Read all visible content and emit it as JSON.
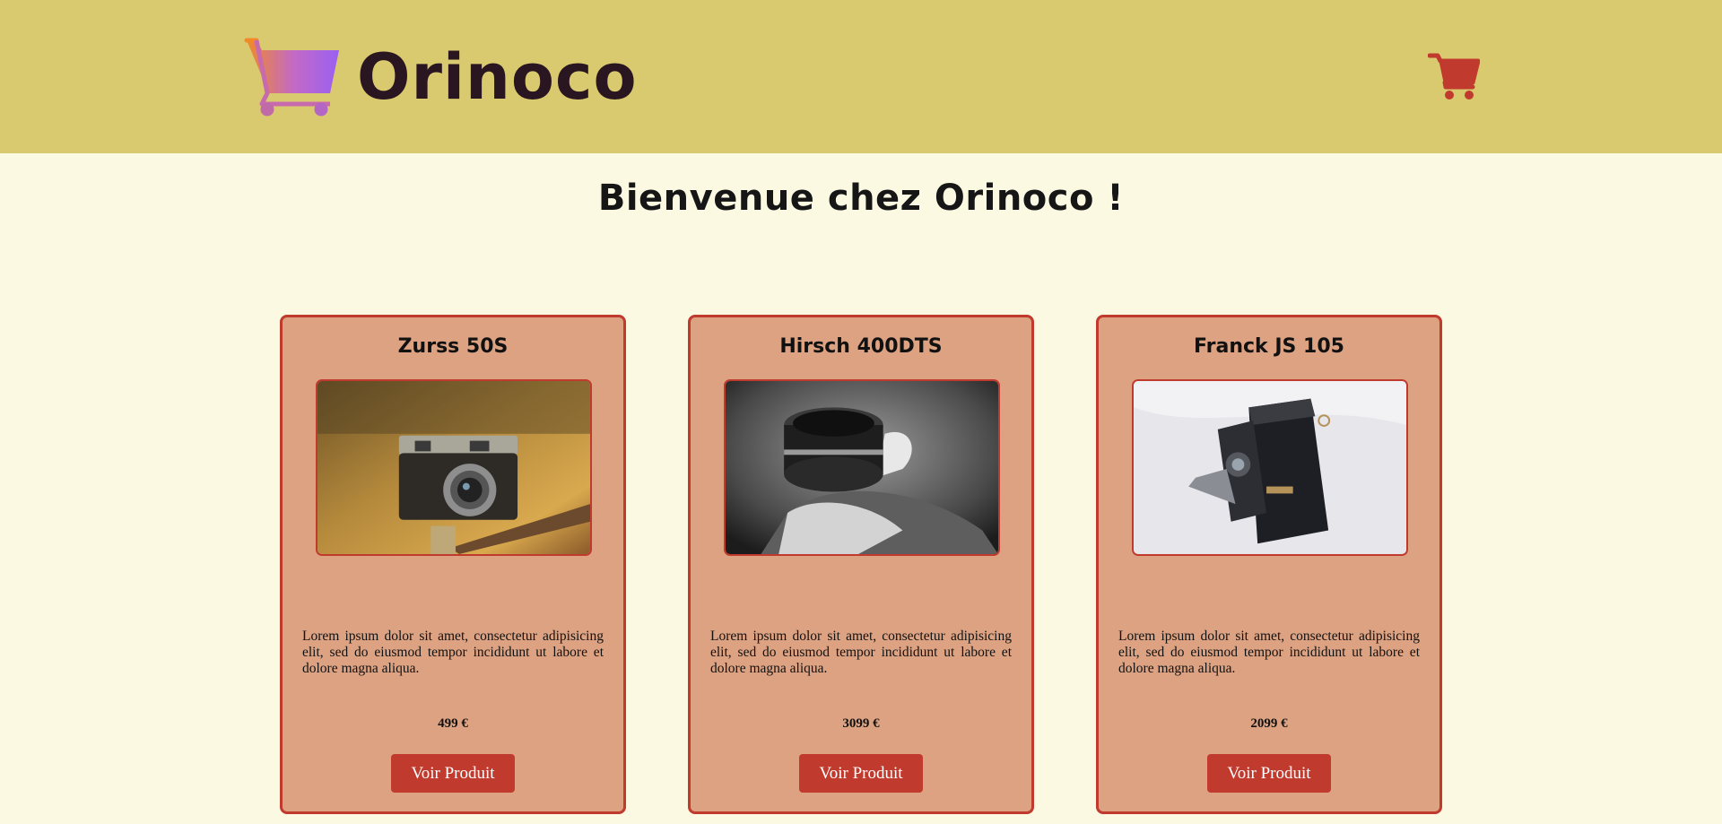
{
  "header": {
    "brand": "Orinoco",
    "logo_icon": "shopping-cart-gradient-icon",
    "cart_icon": "shopping-cart-icon",
    "cart_color": "#c13a2e",
    "background": "#d9ca6f"
  },
  "main": {
    "heading": "Bienvenue chez Orinoco !"
  },
  "products": [
    {
      "name": "Zurss 50S",
      "description": "Lorem ipsum dolor sit amet, consectetur adipisicing elit, sed do eiusmod tempor incididunt ut labore et dolore magna aliqua.",
      "price": "499 €",
      "button_label": "Voir Produit",
      "image": "vintage-camera-photo"
    },
    {
      "name": "Hirsch 400DTS",
      "description": "Lorem ipsum dolor sit amet, consectetur adipisicing elit, sed do eiusmod tempor incididunt ut labore et dolore magna aliqua.",
      "price": "3099 €",
      "button_label": "Voir Produit",
      "image": "camera-lens-bw-photo"
    },
    {
      "name": "Franck JS 105",
      "description": "Lorem ipsum dolor sit amet, consectetur adipisicing elit, sed do eiusmod tempor incididunt ut labore et dolore magna aliqua.",
      "price": "2099 €",
      "button_label": "Voir Produit",
      "image": "folding-camera-photo"
    }
  ],
  "colors": {
    "page_background": "#fcf9e2",
    "card_background": "#dda282",
    "accent": "#c13a2e"
  }
}
